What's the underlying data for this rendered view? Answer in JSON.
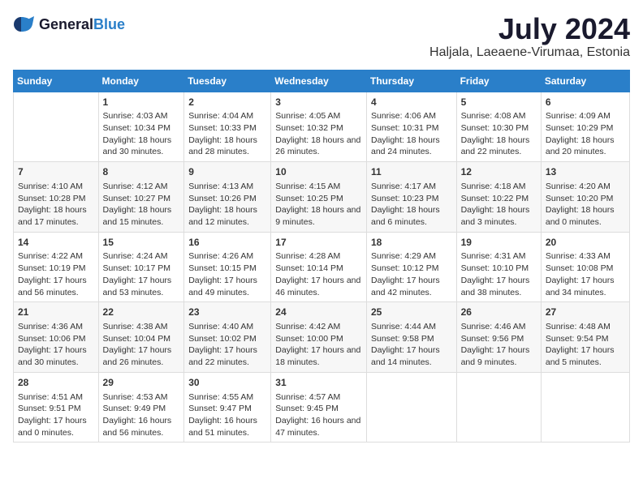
{
  "logo": {
    "text_general": "General",
    "text_blue": "Blue"
  },
  "header": {
    "month": "July 2024",
    "location": "Haljala, Laeaene-Virumaa, Estonia"
  },
  "weekdays": [
    "Sunday",
    "Monday",
    "Tuesday",
    "Wednesday",
    "Thursday",
    "Friday",
    "Saturday"
  ],
  "weeks": [
    [
      {
        "day": "",
        "info": ""
      },
      {
        "day": "1",
        "info": "Sunrise: 4:03 AM\nSunset: 10:34 PM\nDaylight: 18 hours and 30 minutes."
      },
      {
        "day": "2",
        "info": "Sunrise: 4:04 AM\nSunset: 10:33 PM\nDaylight: 18 hours and 28 minutes."
      },
      {
        "day": "3",
        "info": "Sunrise: 4:05 AM\nSunset: 10:32 PM\nDaylight: 18 hours and 26 minutes."
      },
      {
        "day": "4",
        "info": "Sunrise: 4:06 AM\nSunset: 10:31 PM\nDaylight: 18 hours and 24 minutes."
      },
      {
        "day": "5",
        "info": "Sunrise: 4:08 AM\nSunset: 10:30 PM\nDaylight: 18 hours and 22 minutes."
      },
      {
        "day": "6",
        "info": "Sunrise: 4:09 AM\nSunset: 10:29 PM\nDaylight: 18 hours and 20 minutes."
      }
    ],
    [
      {
        "day": "7",
        "info": "Sunrise: 4:10 AM\nSunset: 10:28 PM\nDaylight: 18 hours and 17 minutes."
      },
      {
        "day": "8",
        "info": "Sunrise: 4:12 AM\nSunset: 10:27 PM\nDaylight: 18 hours and 15 minutes."
      },
      {
        "day": "9",
        "info": "Sunrise: 4:13 AM\nSunset: 10:26 PM\nDaylight: 18 hours and 12 minutes."
      },
      {
        "day": "10",
        "info": "Sunrise: 4:15 AM\nSunset: 10:25 PM\nDaylight: 18 hours and 9 minutes."
      },
      {
        "day": "11",
        "info": "Sunrise: 4:17 AM\nSunset: 10:23 PM\nDaylight: 18 hours and 6 minutes."
      },
      {
        "day": "12",
        "info": "Sunrise: 4:18 AM\nSunset: 10:22 PM\nDaylight: 18 hours and 3 minutes."
      },
      {
        "day": "13",
        "info": "Sunrise: 4:20 AM\nSunset: 10:20 PM\nDaylight: 18 hours and 0 minutes."
      }
    ],
    [
      {
        "day": "14",
        "info": "Sunrise: 4:22 AM\nSunset: 10:19 PM\nDaylight: 17 hours and 56 minutes."
      },
      {
        "day": "15",
        "info": "Sunrise: 4:24 AM\nSunset: 10:17 PM\nDaylight: 17 hours and 53 minutes."
      },
      {
        "day": "16",
        "info": "Sunrise: 4:26 AM\nSunset: 10:15 PM\nDaylight: 17 hours and 49 minutes."
      },
      {
        "day": "17",
        "info": "Sunrise: 4:28 AM\nSunset: 10:14 PM\nDaylight: 17 hours and 46 minutes."
      },
      {
        "day": "18",
        "info": "Sunrise: 4:29 AM\nSunset: 10:12 PM\nDaylight: 17 hours and 42 minutes."
      },
      {
        "day": "19",
        "info": "Sunrise: 4:31 AM\nSunset: 10:10 PM\nDaylight: 17 hours and 38 minutes."
      },
      {
        "day": "20",
        "info": "Sunrise: 4:33 AM\nSunset: 10:08 PM\nDaylight: 17 hours and 34 minutes."
      }
    ],
    [
      {
        "day": "21",
        "info": "Sunrise: 4:36 AM\nSunset: 10:06 PM\nDaylight: 17 hours and 30 minutes."
      },
      {
        "day": "22",
        "info": "Sunrise: 4:38 AM\nSunset: 10:04 PM\nDaylight: 17 hours and 26 minutes."
      },
      {
        "day": "23",
        "info": "Sunrise: 4:40 AM\nSunset: 10:02 PM\nDaylight: 17 hours and 22 minutes."
      },
      {
        "day": "24",
        "info": "Sunrise: 4:42 AM\nSunset: 10:00 PM\nDaylight: 17 hours and 18 minutes."
      },
      {
        "day": "25",
        "info": "Sunrise: 4:44 AM\nSunset: 9:58 PM\nDaylight: 17 hours and 14 minutes."
      },
      {
        "day": "26",
        "info": "Sunrise: 4:46 AM\nSunset: 9:56 PM\nDaylight: 17 hours and 9 minutes."
      },
      {
        "day": "27",
        "info": "Sunrise: 4:48 AM\nSunset: 9:54 PM\nDaylight: 17 hours and 5 minutes."
      }
    ],
    [
      {
        "day": "28",
        "info": "Sunrise: 4:51 AM\nSunset: 9:51 PM\nDaylight: 17 hours and 0 minutes."
      },
      {
        "day": "29",
        "info": "Sunrise: 4:53 AM\nSunset: 9:49 PM\nDaylight: 16 hours and 56 minutes."
      },
      {
        "day": "30",
        "info": "Sunrise: 4:55 AM\nSunset: 9:47 PM\nDaylight: 16 hours and 51 minutes."
      },
      {
        "day": "31",
        "info": "Sunrise: 4:57 AM\nSunset: 9:45 PM\nDaylight: 16 hours and 47 minutes."
      },
      {
        "day": "",
        "info": ""
      },
      {
        "day": "",
        "info": ""
      },
      {
        "day": "",
        "info": ""
      }
    ]
  ]
}
